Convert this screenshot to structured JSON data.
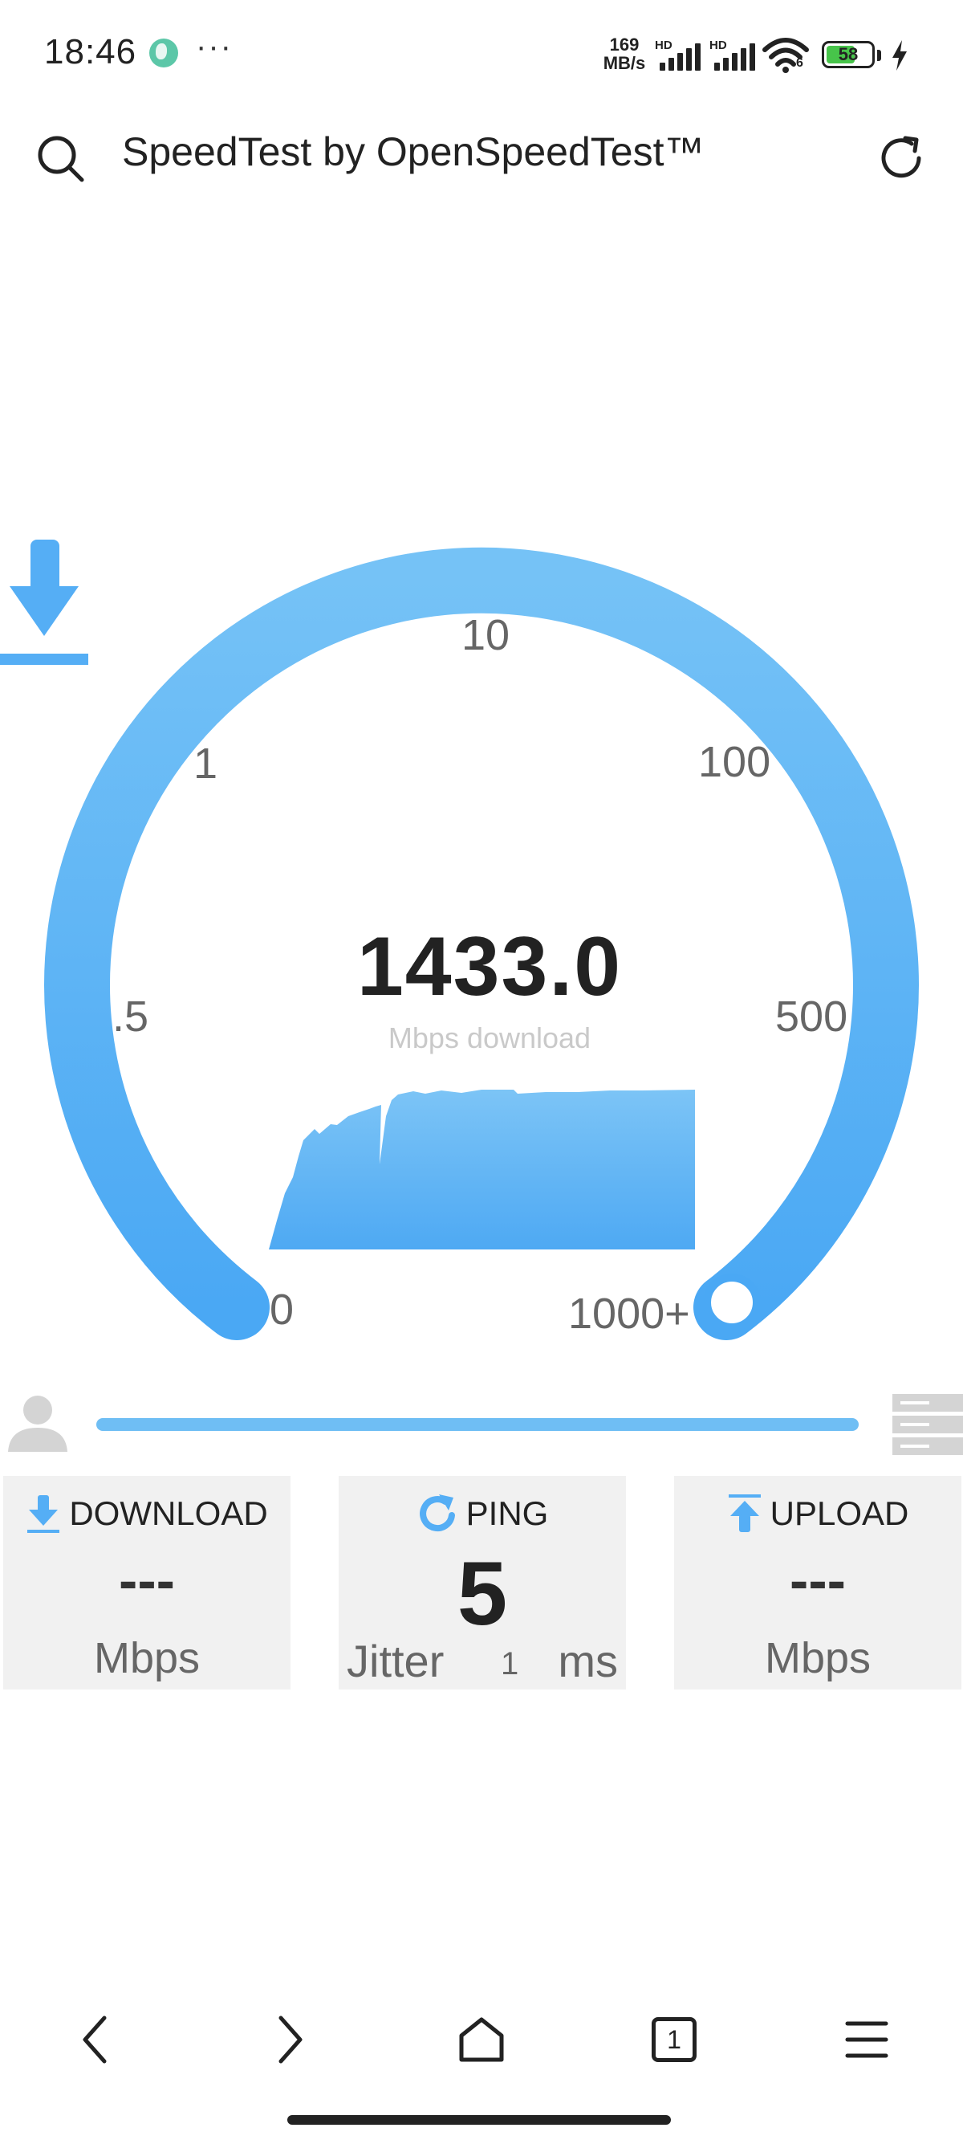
{
  "status_bar": {
    "time": "18:46",
    "more": "···",
    "net_speed_value": "169",
    "net_speed_unit": "MB/s",
    "sim1_tag": "HD",
    "sim2_tag": "HD",
    "wifi_label": "6",
    "battery_level": "58"
  },
  "browser": {
    "title": "SpeedTest by OpenSpeedTest™",
    "search_icon": "search-icon",
    "refresh_icon": "refresh-icon"
  },
  "gauge": {
    "ticks": {
      "t0": "0",
      "t05": ".5",
      "t1": "1",
      "t10": "10",
      "t100": "100",
      "t500": "500",
      "t1000": "1000+"
    },
    "speed": "1433.0",
    "unit": "Mbps download",
    "accent": "#55aef5"
  },
  "results": {
    "download": {
      "label": "DOWNLOAD",
      "value": "---",
      "unit": "Mbps"
    },
    "ping": {
      "label": "PING",
      "value": "5",
      "jitter_label": "Jitter",
      "jitter_value": "1",
      "unit": "ms"
    },
    "upload": {
      "label": "UPLOAD",
      "value": "---",
      "unit": "Mbps"
    }
  },
  "navbar": {
    "tab_count": "1",
    "icons": [
      "back-icon",
      "forward-icon",
      "home-icon",
      "tabs-icon",
      "menu-icon"
    ]
  }
}
